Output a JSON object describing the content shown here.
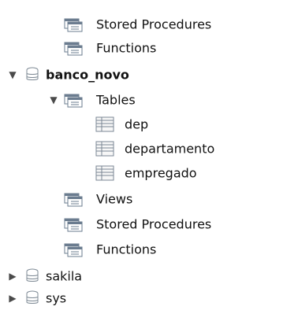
{
  "schema_tree": {
    "rows": [
      {
        "label": "Stored Procedures",
        "icon": "folder-group-icon"
      },
      {
        "label": "Functions",
        "icon": "folder-group-icon"
      },
      {
        "label": "banco_novo",
        "icon": "database-icon",
        "expanded": true,
        "selected": false
      },
      {
        "label": "Tables",
        "icon": "folder-group-icon",
        "expanded": true
      },
      {
        "label": "dep",
        "icon": "table-icon",
        "expanded": false
      },
      {
        "label": "departamento",
        "icon": "table-icon",
        "expanded": false
      },
      {
        "label": "empregado",
        "icon": "table-icon",
        "expanded": false
      },
      {
        "label": "Views",
        "icon": "folder-group-icon"
      },
      {
        "label": "Stored Procedures",
        "icon": "folder-group-icon"
      },
      {
        "label": "Functions",
        "icon": "folder-group-icon"
      },
      {
        "label": "sakila",
        "icon": "database-icon",
        "expanded": false
      },
      {
        "label": "sys",
        "icon": "database-icon",
        "expanded": false
      }
    ]
  },
  "colors": {
    "caret": "#4a4a4a",
    "text": "#111111",
    "folder_icon": "#6b7c8f",
    "table_icon_border": "#7b8794",
    "db_icon": "#7f8b96"
  }
}
